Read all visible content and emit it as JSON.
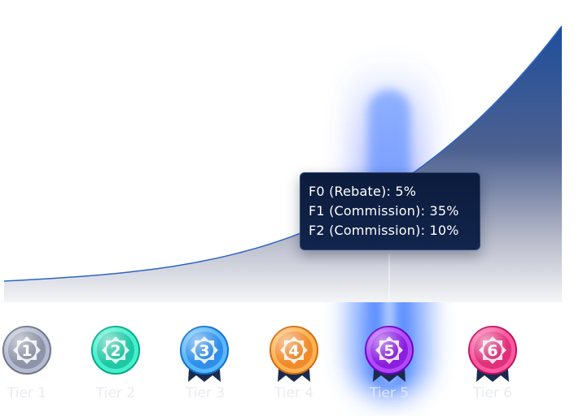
{
  "chart_data": {
    "type": "area",
    "categories": [
      "Tier 1",
      "Tier 2",
      "Tier 3",
      "Tier 4",
      "Tier 5",
      "Tier 6"
    ],
    "active_index": 4,
    "grid": false,
    "tooltip": {
      "lines": [
        "F0 (Rebate): 5%",
        "F1 (Commission): 35%",
        "F2 (Commission): 10%"
      ]
    },
    "badges": [
      {
        "number": "1",
        "color": "#8d93a8",
        "ribbon": false
      },
      {
        "number": "2",
        "color": "#1ec8a5",
        "ribbon": false
      },
      {
        "number": "3",
        "color": "#2f8fe8",
        "ribbon": true
      },
      {
        "number": "4",
        "color": "#f08a2a",
        "ribbon": true
      },
      {
        "number": "5",
        "color": "#8a1fe0",
        "ribbon": true
      },
      {
        "number": "6",
        "color": "#e0307a",
        "ribbon": true
      }
    ],
    "colors": {
      "curve": "#2f64c8",
      "area_top": "#1f4e9c",
      "area_bottom": "#f4f5f7",
      "highlight": "#3f7bff"
    }
  }
}
